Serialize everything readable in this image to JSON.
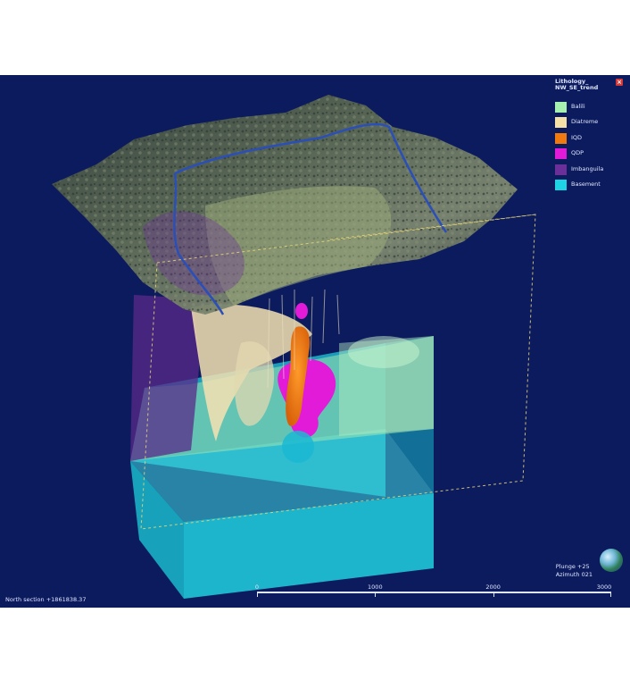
{
  "legend": {
    "title_line1": "Lithology_",
    "title_line2": "NW_SE_trend",
    "items": [
      {
        "label": "Balili",
        "color": "#a6f0b0"
      },
      {
        "label": "Diatreme",
        "color": "#f5e0a8"
      },
      {
        "label": "IQD",
        "color": "#f07a10"
      },
      {
        "label": "QDP",
        "color": "#e21bd9"
      },
      {
        "label": "Imbanguila",
        "color": "#6b2f9a"
      },
      {
        "label": "Basement",
        "color": "#1fd3e6"
      }
    ],
    "close_icon": "close-icon"
  },
  "view": {
    "plunge": "Plunge +25",
    "azimuth": "Azimuth 021",
    "north_section": "North section +1861838.37",
    "background": "#0c1b5e"
  },
  "scale": {
    "labels": [
      "0",
      "1000",
      "2000",
      "3000"
    ],
    "max": 3000
  }
}
